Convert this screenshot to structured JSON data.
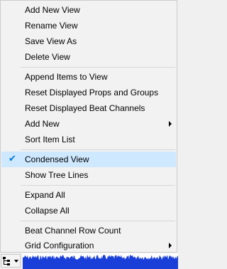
{
  "menu": {
    "items": [
      {
        "label": "Add New View"
      },
      {
        "label": "Rename View"
      },
      {
        "label": "Save View As"
      },
      {
        "label": "Delete View"
      },
      {
        "label": "Append Items to View"
      },
      {
        "label": "Reset Displayed Props and Groups"
      },
      {
        "label": "Reset Displayed Beat Channels"
      },
      {
        "label": "Add New",
        "submenu": true
      },
      {
        "label": "Sort Item List"
      },
      {
        "label": "Condensed View",
        "checked": true
      },
      {
        "label": "Show Tree Lines"
      },
      {
        "label": "Expand All"
      },
      {
        "label": "Collapse All"
      },
      {
        "label": "Beat Channel Row Count"
      },
      {
        "label": "Grid Configuration",
        "submenu": true
      }
    ]
  },
  "colors": {
    "checked_highlight": "#cde8ff",
    "check_mark": "#0078d7",
    "waveform": "#1a3fd8"
  },
  "icons": {
    "check": "check-icon",
    "submenu": "submenu-arrow-icon",
    "tree": "tree-view-icon",
    "dropdown": "chevron-down-icon"
  }
}
